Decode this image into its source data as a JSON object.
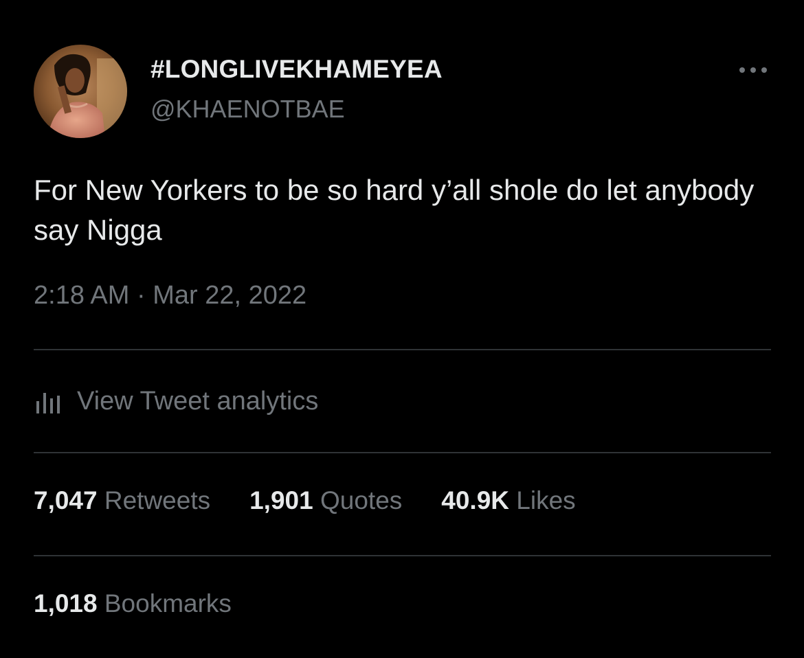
{
  "author": {
    "display_name": "#LONGLIVEKHAMEYEA",
    "handle": "@KHAENOTBAE",
    "avatar_icon": "profile-photo"
  },
  "more_icon": "more-horizontal-icon",
  "tweet": {
    "text": "For New Yorkers to be so hard y’all shole do let anybody say Nigga",
    "timestamp": "2:18 AM · Mar 22, 2022"
  },
  "analytics": {
    "icon": "bar-chart-icon",
    "label": "View Tweet analytics"
  },
  "stats": {
    "retweets": {
      "count": "7,047",
      "label": "Retweets"
    },
    "quotes": {
      "count": "1,901",
      "label": "Quotes"
    },
    "likes": {
      "count": "40.9K",
      "label": "Likes"
    },
    "bookmarks": {
      "count": "1,018",
      "label": "Bookmarks"
    }
  },
  "colors": {
    "background": "#000000",
    "primary_text": "#e7e9ea",
    "secondary_text": "#71767b",
    "divider": "#2f3336"
  }
}
